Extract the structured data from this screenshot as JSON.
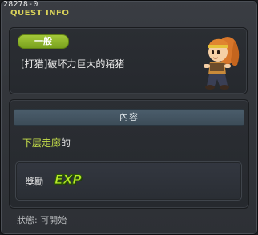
{
  "window": {
    "quest_id": "28278-0",
    "title": "QUEST INFO"
  },
  "quest": {
    "category": "一般",
    "name": "[打猎]破坏力巨大的猪猪",
    "npc_icon": "npc-girl-portrait-icon"
  },
  "content": {
    "header": "內容",
    "objective_map": "下层走廊",
    "objective_suffix": "的",
    "reward_label": "獎勵",
    "reward_badge": "EXP"
  },
  "status": {
    "text": "狀態:  可開始"
  },
  "colors": {
    "title": "#d9d25a",
    "category_pill": "#8fb52a",
    "map_highlight": "#c6e04a",
    "exp_badge": "#b9ea2a",
    "content_header": "#44555f"
  }
}
